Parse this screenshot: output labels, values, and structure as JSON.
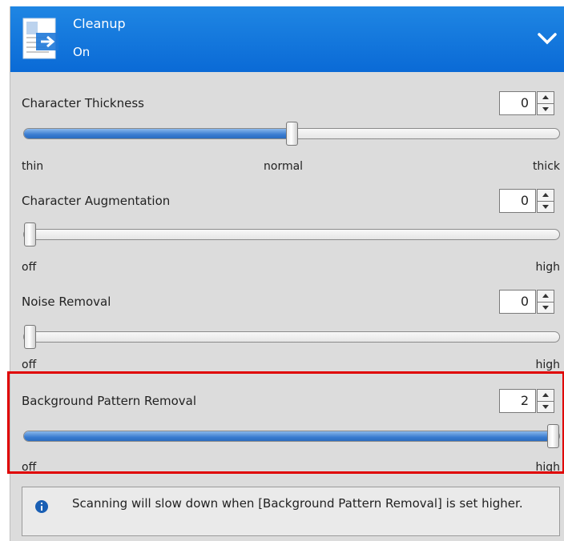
{
  "header": {
    "title": "Cleanup",
    "status": "On",
    "icon": "document-arrow-icon",
    "accent": "#0a6ad6"
  },
  "sections": [
    {
      "label": "Character Thickness",
      "value": "0",
      "slider_fraction": 0.5,
      "ticks": [
        "thin",
        "normal",
        "thick"
      ]
    },
    {
      "label": "Character Augmentation",
      "value": "0",
      "slider_fraction": 0.0,
      "ticks": [
        "off",
        "high"
      ]
    },
    {
      "label": "Noise Removal",
      "value": "0",
      "slider_fraction": 0.0,
      "ticks": [
        "off",
        "high"
      ]
    },
    {
      "label": "Background Pattern Removal",
      "value": "2",
      "slider_fraction": 1.0,
      "ticks": [
        "off",
        "high"
      ]
    }
  ],
  "highlight_color": "#e00000",
  "info": {
    "text": "Scanning will slow down when [Background Pattern Removal] is set higher.",
    "icon": "info-icon"
  }
}
